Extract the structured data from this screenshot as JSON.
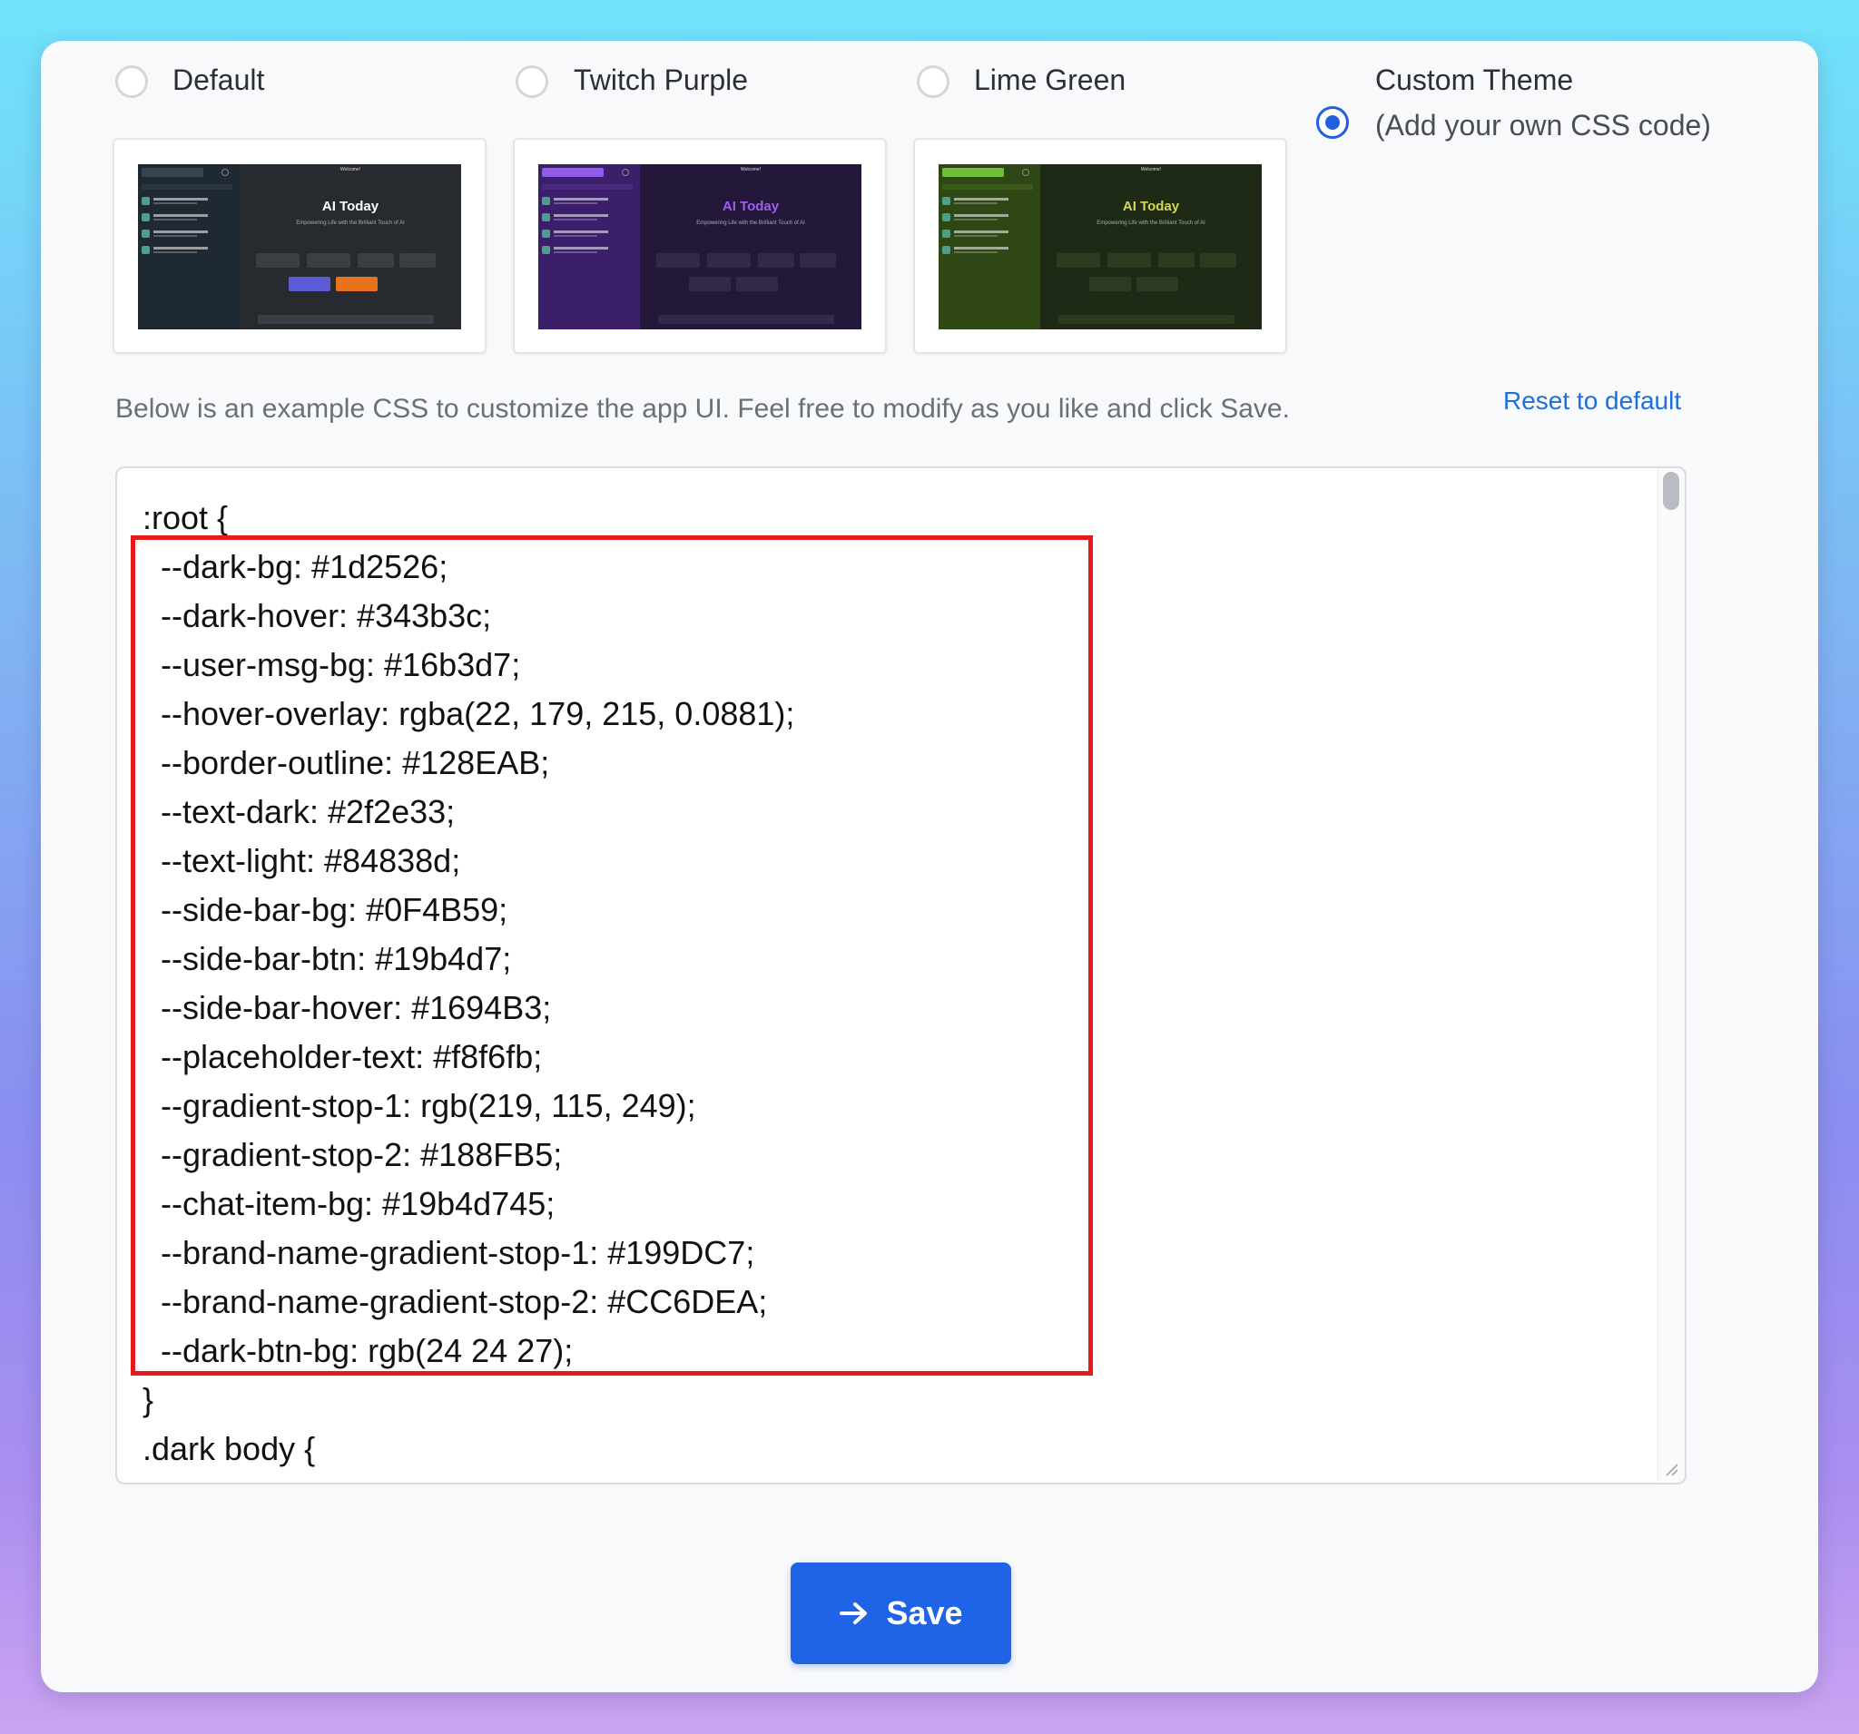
{
  "themes": [
    {
      "label": "Default",
      "checked": false,
      "brand": "AI Today",
      "colors": {
        "side": "#1f2933",
        "main": "#272b30",
        "accent": "#4f9d8a",
        "brand_color": "#ffffff"
      }
    },
    {
      "label": "Twitch Purple",
      "checked": false,
      "brand": "AI Today",
      "colors": {
        "side": "#3b1f6b",
        "main": "#23183a",
        "accent": "#8f5be8",
        "brand_color": "#a35cf0"
      }
    },
    {
      "label": "Lime Green",
      "checked": false,
      "brand": "AI Today",
      "colors": {
        "side": "#2f4715",
        "main": "#1f2a16",
        "accent": "#6fbf3a",
        "brand_color": "#d7d94a"
      }
    },
    {
      "label": "Custom Theme",
      "sublabel": "(Add your own CSS code)",
      "checked": true
    }
  ],
  "hint": "Below is an example CSS to customize the app UI. Feel free to modify as you like and click Save.",
  "reset_label": "Reset to default",
  "code_lines": [
    ":root {",
    "  --dark-bg: #1d2526;",
    "  --dark-hover: #343b3c;",
    "  --user-msg-bg: #16b3d7;",
    "  --hover-overlay: rgba(22, 179, 215, 0.0881);",
    "  --border-outline: #128EAB;",
    "  --text-dark: #2f2e33;",
    "  --text-light: #84838d;",
    "  --side-bar-bg: #0F4B59;",
    "  --side-bar-btn: #19b4d7;",
    "  --side-bar-hover: #1694B3;",
    "  --placeholder-text: #f8f6fb;",
    "  --gradient-stop-1: rgb(219, 115, 249);",
    "  --gradient-stop-2: #188FB5;",
    "  --chat-item-bg: #19b4d745;",
    "  --brand-name-gradient-stop-1: #199DC7;",
    "  --brand-name-gradient-stop-2: #CC6DEA;",
    "  --dark-btn-bg: rgb(24 24 27);",
    "}",
    ".dark body {"
  ],
  "save_label": "Save",
  "accent_color": "#1f63e6",
  "highlight_color": "#e51b1b"
}
